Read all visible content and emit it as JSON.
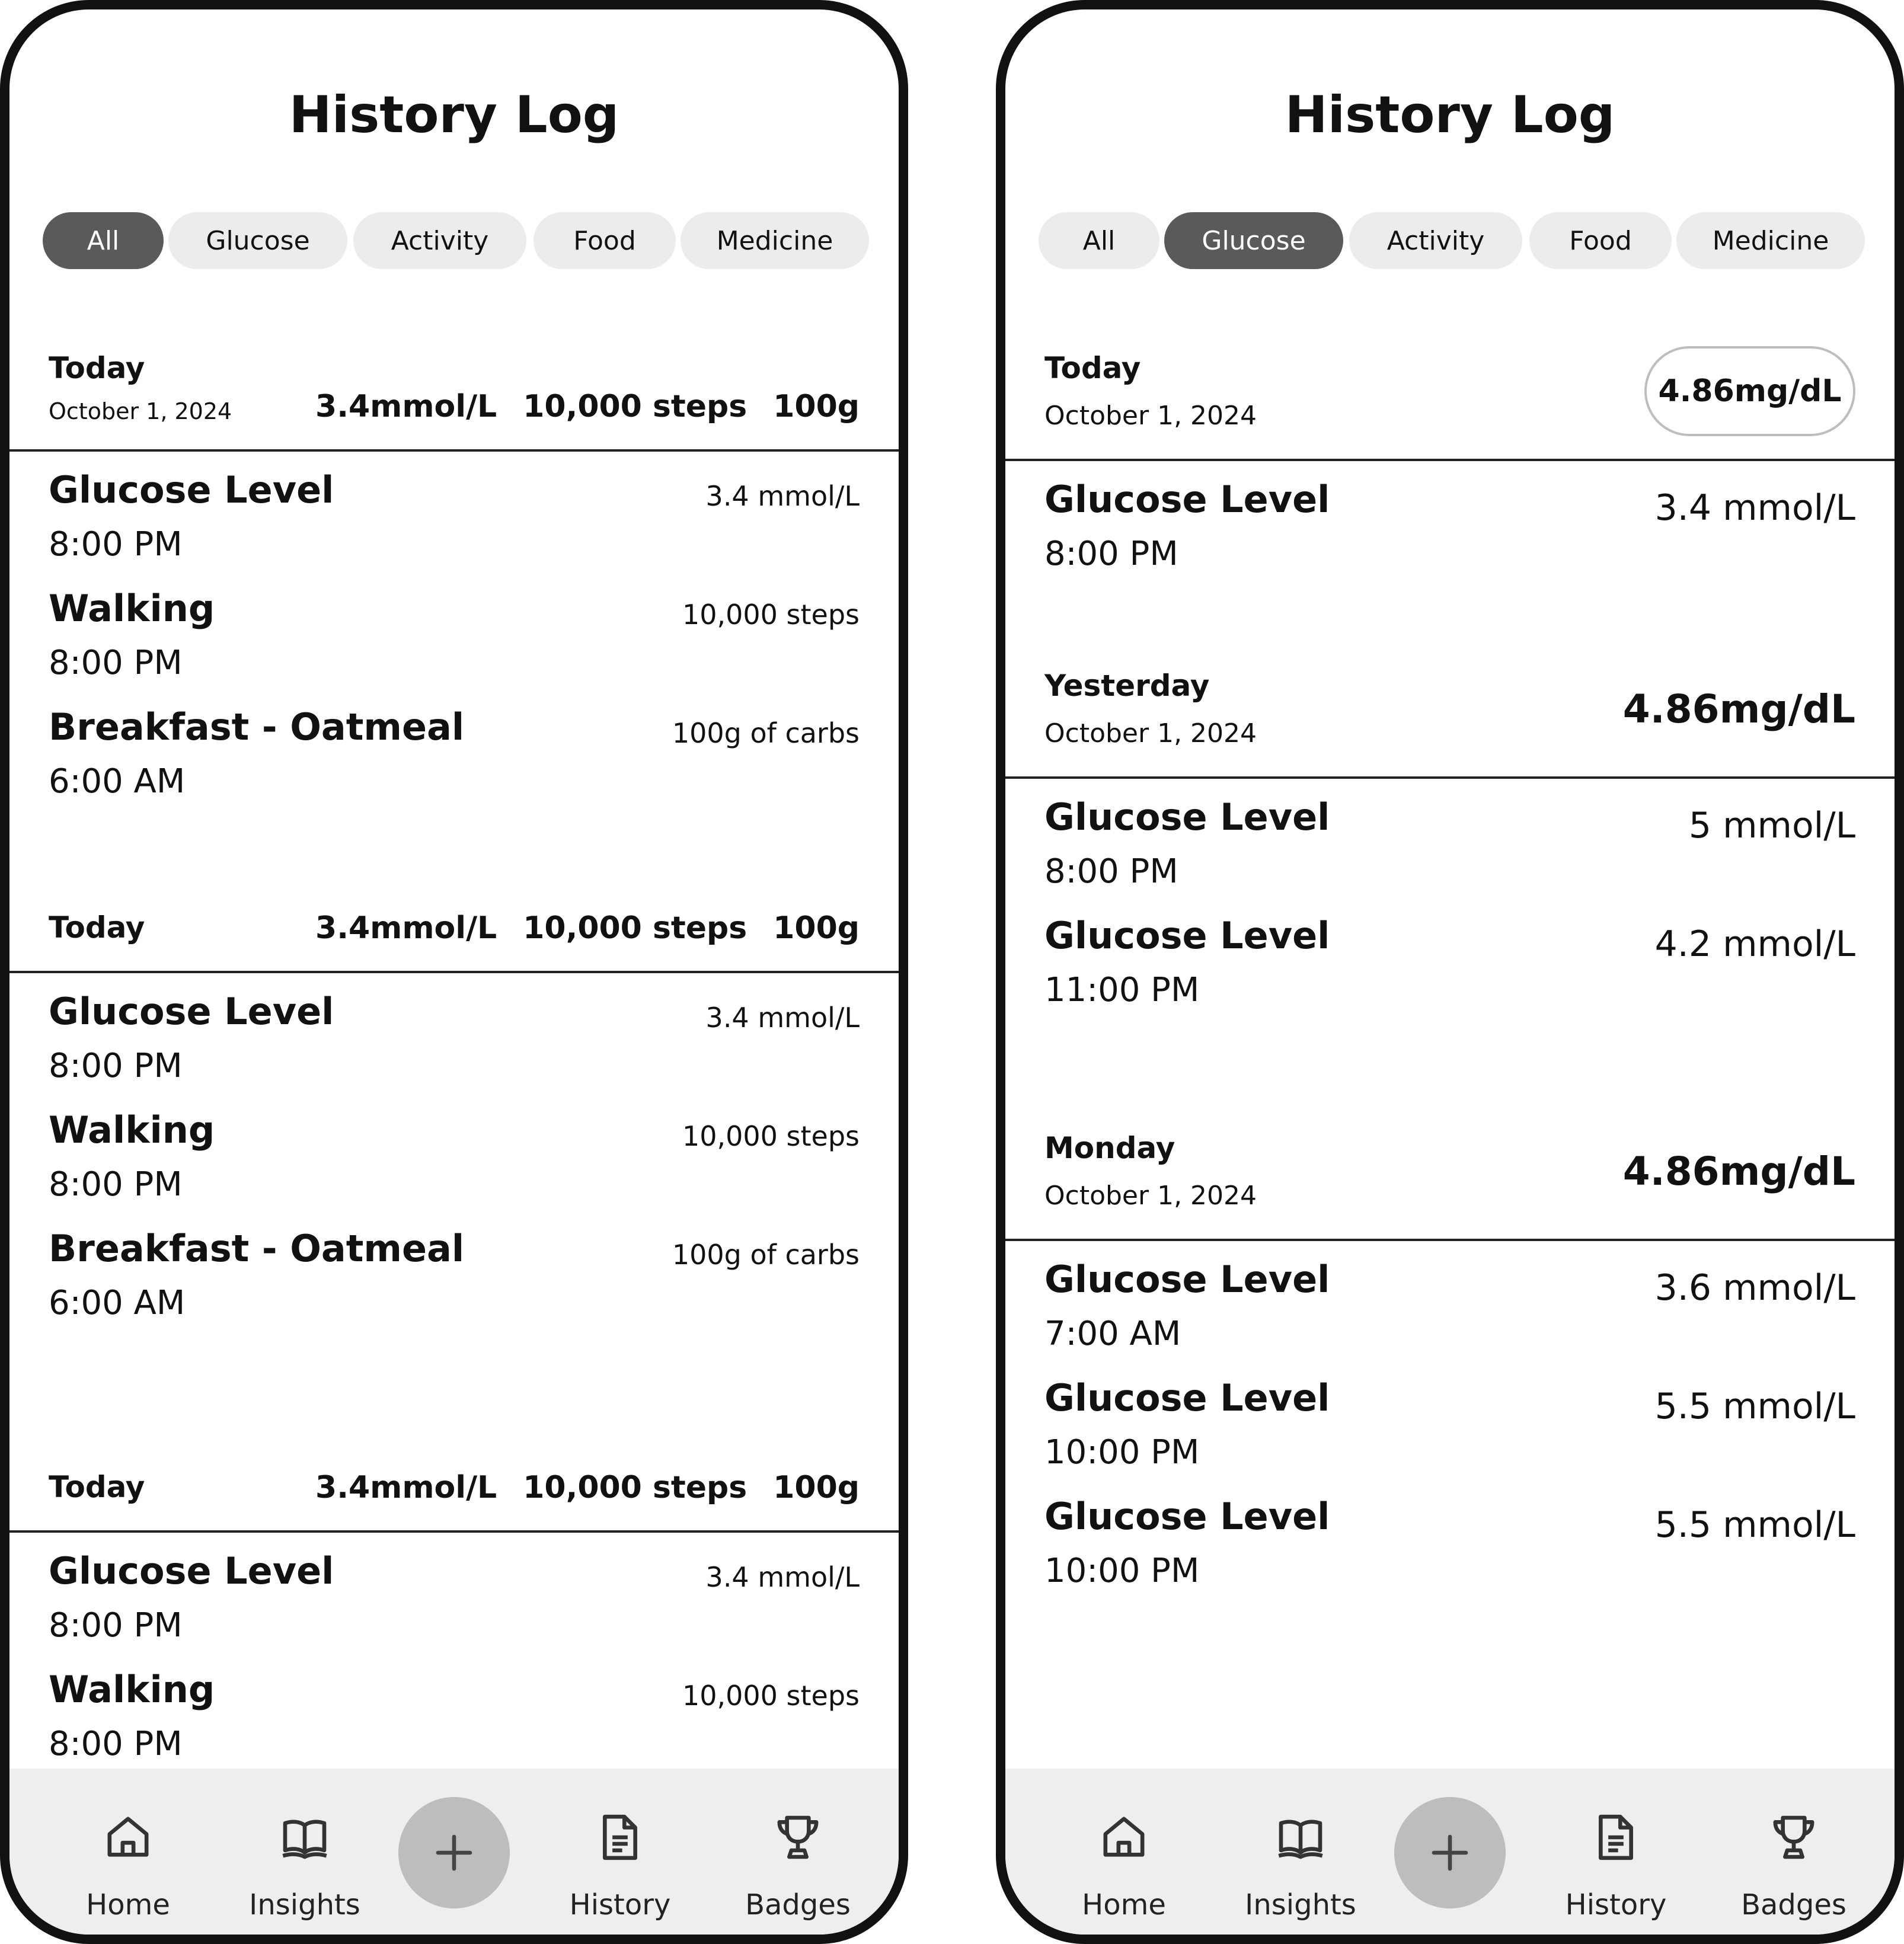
{
  "left": {
    "title": "History Log",
    "filters": [
      "All",
      "Glucose",
      "Activity",
      "Food",
      "Medicine"
    ],
    "active_filter": "All",
    "sections": [
      {
        "day": "Today",
        "date": "October 1, 2024",
        "summary": [
          "3.4mmol/L",
          "10,000 steps",
          "100g"
        ],
        "entries": [
          {
            "title": "Glucose Level",
            "time": "8:00 PM",
            "value": "3.4 mmol/L"
          },
          {
            "title": "Walking",
            "time": "8:00 PM",
            "value": "10,000 steps"
          },
          {
            "title": "Breakfast - Oatmeal",
            "time": "6:00 AM",
            "value": "100g of carbs"
          }
        ]
      },
      {
        "day": "Today",
        "summary": [
          "3.4mmol/L",
          "10,000 steps",
          "100g"
        ],
        "entries": [
          {
            "title": "Glucose Level",
            "time": "8:00 PM",
            "value": "3.4 mmol/L"
          },
          {
            "title": "Walking",
            "time": "8:00 PM",
            "value": "10,000 steps"
          },
          {
            "title": "Breakfast - Oatmeal",
            "time": "6:00 AM",
            "value": "100g of carbs"
          }
        ]
      },
      {
        "day": "Today",
        "summary": [
          "3.4mmol/L",
          "10,000 steps",
          "100g"
        ],
        "entries": [
          {
            "title": "Glucose Level",
            "time": "8:00 PM",
            "value": "3.4 mmol/L"
          },
          {
            "title": "Walking",
            "time": "8:00 PM",
            "value": "10,000 steps"
          }
        ]
      }
    ]
  },
  "right": {
    "title": "History Log",
    "filters": [
      "All",
      "Glucose",
      "Activity",
      "Food",
      "Medicine"
    ],
    "active_filter": "Glucose",
    "sections": [
      {
        "day": "Today",
        "date": "October 1, 2024",
        "average": "4.86mg/dL",
        "entries": [
          {
            "title": "Glucose Level",
            "time": "8:00 PM",
            "value": "3.4 mmol/L"
          }
        ]
      },
      {
        "day": "Yesterday",
        "date": "October 1, 2024",
        "average": "4.86mg/dL",
        "entries": [
          {
            "title": "Glucose Level",
            "time": "8:00 PM",
            "value": "5 mmol/L"
          },
          {
            "title": "Glucose Level",
            "time": "11:00 PM",
            "value": "4.2 mmol/L"
          }
        ]
      },
      {
        "day": "Monday",
        "date": "October 1, 2024",
        "average": "4.86mg/dL",
        "entries": [
          {
            "title": "Glucose Level",
            "time": "7:00 AM",
            "value": "3.6 mmol/L"
          },
          {
            "title": "Glucose Level",
            "time": "10:00 PM",
            "value": "5.5 mmol/L"
          },
          {
            "title": "Glucose Level",
            "time": "10:00 PM",
            "value": "5.5 mmol/L"
          }
        ]
      }
    ]
  },
  "nav": {
    "items": [
      {
        "label": "Home",
        "icon": "home-icon"
      },
      {
        "label": "Insights",
        "icon": "book-icon"
      },
      {
        "label": "History",
        "icon": "document-icon"
      },
      {
        "label": "Badges",
        "icon": "trophy-icon"
      }
    ],
    "fab_icon": "plus-icon"
  }
}
